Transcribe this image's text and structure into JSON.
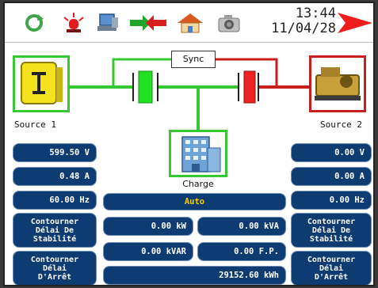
{
  "clock": {
    "time": "13:44",
    "date": "11/04/28"
  },
  "toolbar": {
    "icons": [
      "refresh-icon",
      "alarm-light-icon",
      "computer-icon",
      "transfer-arrows-icon",
      "home-icon",
      "camera-icon"
    ],
    "next": "next-arrow-icon"
  },
  "diagram": {
    "sync_label": "Sync",
    "source1_label": "Source 1",
    "source2_label": "Source 2",
    "charge_label": "Charge",
    "colors": {
      "source1": "#36c832",
      "source2": "#c81e1e",
      "bus": "#36c832",
      "breaker_closed": "#22e022",
      "breaker_open": "#ee2222"
    }
  },
  "source1": {
    "voltage": "599.50 V",
    "current": "0.48 A",
    "frequency": "60.00 Hz",
    "stability_btn": "Contourner\nDélai De\nStabilité",
    "stop_btn": "Contourner\nDélai\nD'Arrêt"
  },
  "source2": {
    "voltage": "0.00 V",
    "current": "0.00 A",
    "frequency": "0.00 Hz",
    "stability_btn": "Contourner\nDélai De\nStabilité",
    "stop_btn": "Contourner\nDélai\nD'Arrêt"
  },
  "load": {
    "mode": "Auto",
    "kw": "0.00 kW",
    "kva": "0.00 kVA",
    "kvar": "0.00 kVAR",
    "pf": "0.00 F.P.",
    "kwh": "29152.60 kWh"
  }
}
